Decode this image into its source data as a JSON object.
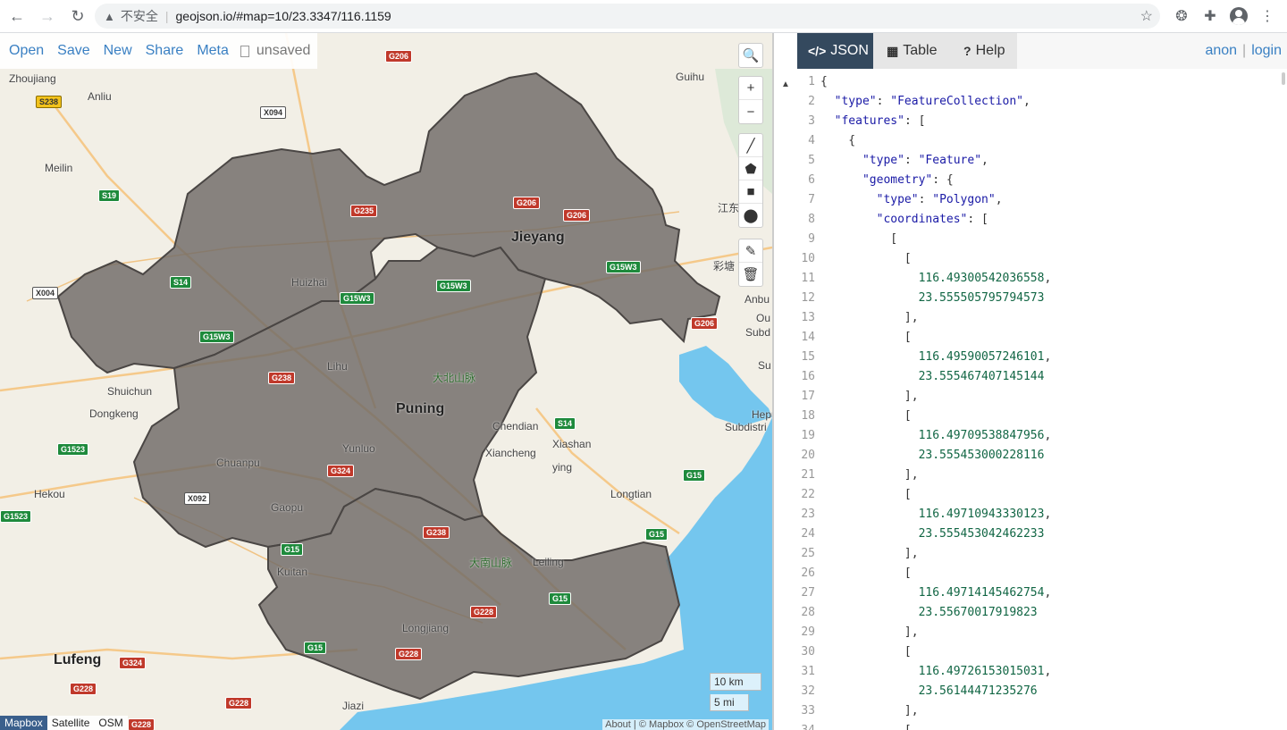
{
  "browser": {
    "back": "←",
    "forward": "→",
    "reload": "↻",
    "security_label": "不安全",
    "url": "geojson.io/#map=10/23.3347/116.1159"
  },
  "map_menu": {
    "items": [
      "Open",
      "Save",
      "New",
      "Share",
      "Meta"
    ],
    "status": "unsaved"
  },
  "map_tools": {
    "search": "🔍",
    "zoom_in": "+",
    "zoom_out": "−",
    "draw_line": "╱",
    "draw_polygon": "⬟",
    "draw_rectangle": "■",
    "draw_marker": "⬤",
    "edit": "✎",
    "delete": "🗑"
  },
  "scale": {
    "metric": "10 km",
    "imperial": "5 mi"
  },
  "layers": [
    "Mapbox",
    "Satellite",
    "OSM"
  ],
  "active_layer": "Mapbox",
  "attribution": "About | © Mapbox © OpenStreetMap",
  "map_labels": {
    "places": [
      {
        "text": "Zhoujiang",
        "cls": "p"
      },
      {
        "text": "Anliu",
        "cls": "p"
      },
      {
        "text": "Meilin",
        "cls": "p"
      },
      {
        "text": "Huizhai",
        "cls": "p"
      },
      {
        "text": "Jieyang",
        "cls": "city"
      },
      {
        "text": "Lihu",
        "cls": "p"
      },
      {
        "text": "Puning",
        "cls": "city"
      },
      {
        "text": "Shuichun",
        "cls": "p"
      },
      {
        "text": "Dongkeng",
        "cls": "p"
      },
      {
        "text": "Chuanpu",
        "cls": "p"
      },
      {
        "text": "Yunluo",
        "cls": "p"
      },
      {
        "text": "Hekou",
        "cls": "p"
      },
      {
        "text": "Gaopu",
        "cls": "p"
      },
      {
        "text": "Kuitan",
        "cls": "p"
      },
      {
        "text": "Longjiang",
        "cls": "p"
      },
      {
        "text": "Lufeng",
        "cls": "city"
      },
      {
        "text": "Jiazi",
        "cls": "p"
      },
      {
        "text": "Chendian",
        "cls": "p"
      },
      {
        "text": "Xiashan",
        "cls": "p"
      },
      {
        "text": "Xiancheng",
        "cls": "p"
      },
      {
        "text": "ying",
        "cls": "p"
      },
      {
        "text": "Longtian",
        "cls": "p"
      },
      {
        "text": "Leiling",
        "cls": "p"
      },
      {
        "text": "Guihu",
        "cls": "p"
      },
      {
        "text": "江东",
        "cls": "p"
      },
      {
        "text": "彩塘",
        "cls": "p"
      },
      {
        "text": "Anbu",
        "cls": "p"
      },
      {
        "text": "Ou",
        "cls": "p"
      },
      {
        "text": "Subd",
        "cls": "p"
      },
      {
        "text": "Su",
        "cls": "p"
      },
      {
        "text": "Hepu",
        "cls": "p"
      },
      {
        "text": "Subdistri",
        "cls": "p"
      },
      {
        "text": "大北山脉",
        "cls": "mtn"
      },
      {
        "text": "大南山脉",
        "cls": "mtn"
      }
    ],
    "shields": [
      {
        "text": "S238",
        "kind": "yellow"
      },
      {
        "text": "X094",
        "kind": "white"
      },
      {
        "text": "G206",
        "kind": "red"
      },
      {
        "text": "S19",
        "kind": "green"
      },
      {
        "text": "G235",
        "kind": "red"
      },
      {
        "text": "G206",
        "kind": "red"
      },
      {
        "text": "G206",
        "kind": "red"
      },
      {
        "text": "G15W3",
        "kind": "green"
      },
      {
        "text": "X004",
        "kind": "white"
      },
      {
        "text": "S14",
        "kind": "green"
      },
      {
        "text": "G15W3",
        "kind": "green"
      },
      {
        "text": "G15W3",
        "kind": "green"
      },
      {
        "text": "G15W3",
        "kind": "green"
      },
      {
        "text": "G206",
        "kind": "red"
      },
      {
        "text": "G238",
        "kind": "red"
      },
      {
        "text": "S14",
        "kind": "green"
      },
      {
        "text": "G1523",
        "kind": "green"
      },
      {
        "text": "G324",
        "kind": "red"
      },
      {
        "text": "X092",
        "kind": "white"
      },
      {
        "text": "G1523",
        "kind": "green"
      },
      {
        "text": "G15",
        "kind": "green"
      },
      {
        "text": "G15",
        "kind": "green"
      },
      {
        "text": "G238",
        "kind": "red"
      },
      {
        "text": "G15",
        "kind": "green"
      },
      {
        "text": "G15",
        "kind": "green"
      },
      {
        "text": "G228",
        "kind": "red"
      },
      {
        "text": "G15",
        "kind": "green"
      },
      {
        "text": "G228",
        "kind": "red"
      },
      {
        "text": "G324",
        "kind": "red"
      },
      {
        "text": "G228",
        "kind": "red"
      },
      {
        "text": "G228",
        "kind": "red"
      },
      {
        "text": "G228",
        "kind": "red"
      }
    ]
  },
  "tabs": [
    {
      "label": "JSON",
      "icon": "</>"
    },
    {
      "label": "Table",
      "icon": "▦"
    },
    {
      "label": "Help",
      "icon": "?"
    }
  ],
  "auth": {
    "anon": "anon",
    "login": "login"
  },
  "collapse_icon": "▲",
  "editor": {
    "line_numbers": [
      "1",
      "2",
      "3",
      "4",
      "5",
      "6",
      "7",
      "8",
      "9",
      "10",
      "11",
      "12",
      "13",
      "14",
      "15",
      "16",
      "17",
      "18",
      "19",
      "20",
      "21",
      "22",
      "23",
      "24",
      "25",
      "26",
      "27",
      "28",
      "29",
      "30",
      "31",
      "32",
      "33",
      "34"
    ],
    "lines": [
      "{",
      "  \"type\": \"FeatureCollection\",",
      "  \"features\": [",
      "    {",
      "      \"type\": \"Feature\",",
      "      \"geometry\": {",
      "        \"type\": \"Polygon\",",
      "        \"coordinates\": [",
      "          [",
      "            [",
      "              116.49300542036558,",
      "              23.555505795794573",
      "            ],",
      "            [",
      "              116.49590057246101,",
      "              23.555467407145144",
      "            ],",
      "            [",
      "              116.49709538847956,",
      "              23.555453000228116",
      "            ],",
      "            [",
      "              116.49710943330123,",
      "              23.555453042462233",
      "            ],",
      "            [",
      "              116.49714145462754,",
      "              23.55670017919823",
      "            ],",
      "            [",
      "              116.49726153015031,",
      "              23.56144471235276",
      "            ],",
      "            ["
    ]
  },
  "colors": {
    "accent": "#3a80c3",
    "active_tab": "#34495e",
    "polygon_fill": "#6f6a66",
    "water": "#74c6ee"
  }
}
